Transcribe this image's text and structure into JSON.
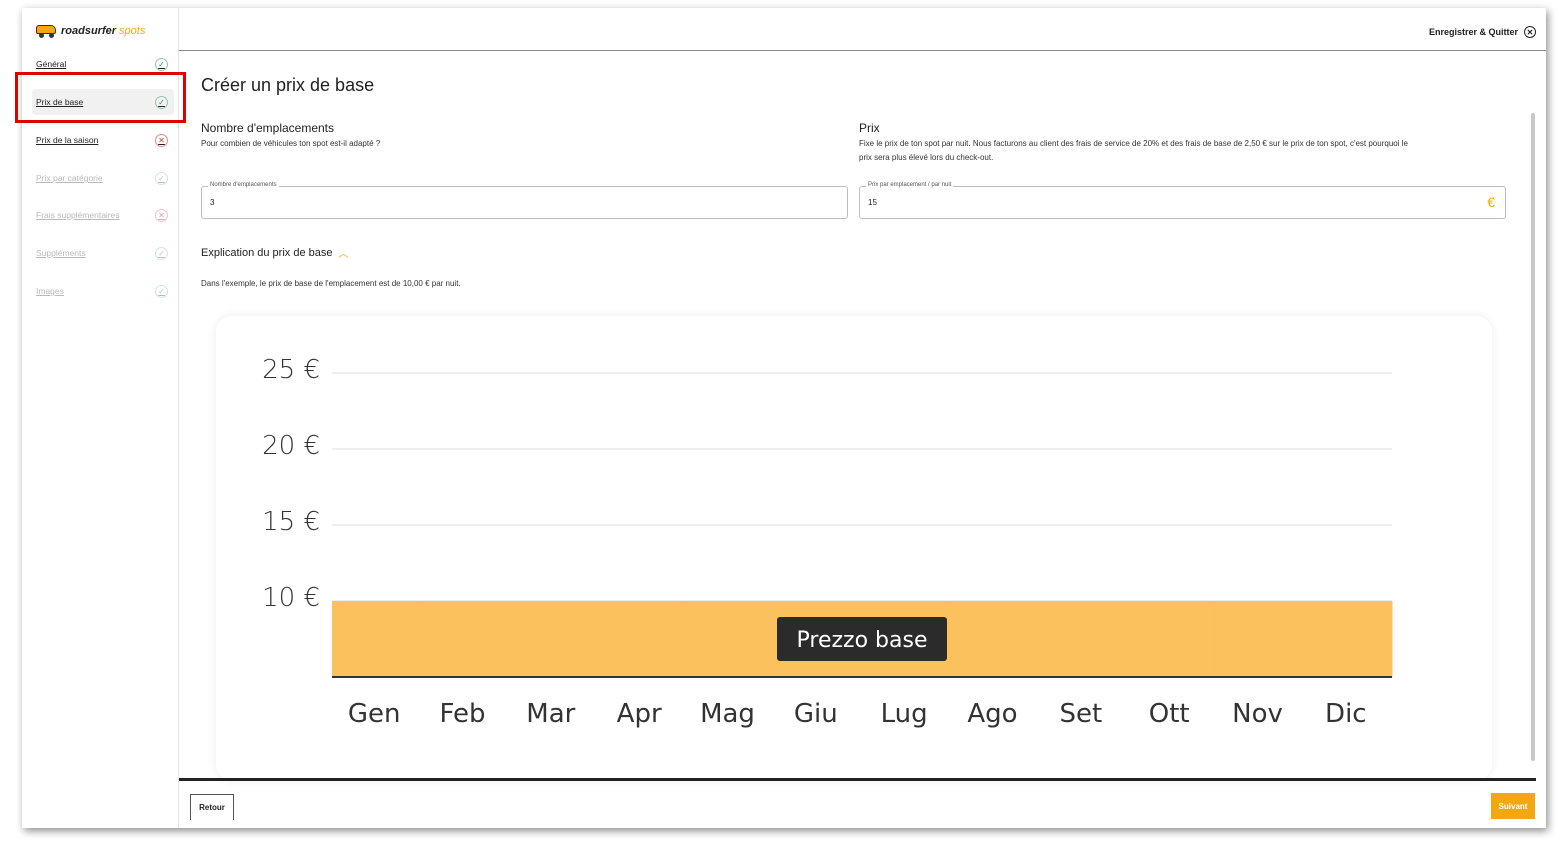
{
  "app": {
    "logo_text": "roadsurfer",
    "logo_suffix": "spots"
  },
  "header": {
    "save_quit": "Enregistrer & Quitter"
  },
  "sidebar": {
    "items": [
      {
        "label": "Général",
        "status": "ok"
      },
      {
        "label": "Prix de base",
        "status": "ok"
      },
      {
        "label": "Prix de la saison",
        "status": "error"
      },
      {
        "label": "Prix par catégorie",
        "status": "ok"
      },
      {
        "label": "Frais supplémentaires",
        "status": "error"
      },
      {
        "label": "Suppléments",
        "status": "ok"
      },
      {
        "label": "Images",
        "status": "ok"
      }
    ]
  },
  "main": {
    "title": "Créer un prix de base",
    "places": {
      "title": "Nombre d'emplacements",
      "desc": "Pour combien de véhicules ton spot est-il adapté ?",
      "field_label": "Nombre d'emplacements",
      "field_value": "3"
    },
    "price": {
      "title": "Prix",
      "desc1": "Fixe le prix de ton spot par nuit. Nous facturons au client des frais de service de 20% et des frais de base de 2,50 € sur le prix de ton spot, c'est pourquoi le",
      "desc2": "prix sera plus élevé lors du check-out.",
      "field_label": "Prix par emplacement / par nuit",
      "field_value": "15",
      "currency": "€"
    },
    "explain_title": "Explication du prix de base",
    "example_text": "Dans l'exemple, le prix de base de l'emplacement est de 10,00 € par nuit."
  },
  "chart_data": {
    "type": "area",
    "categories": [
      "Gen",
      "Feb",
      "Mar",
      "Apr",
      "Mag",
      "Giu",
      "Lug",
      "Ago",
      "Set",
      "Ott",
      "Nov",
      "Dic"
    ],
    "series": [
      {
        "values": [
          10,
          10,
          10,
          10,
          10,
          10,
          10,
          10,
          10,
          10,
          10,
          10
        ]
      }
    ],
    "band_label": "Prezzo base",
    "ylim": [
      5,
      25
    ],
    "yticks": [
      "25 €",
      "20 €",
      "15 €",
      "10 €"
    ],
    "ytick_values": [
      25,
      20,
      15,
      10
    ],
    "grid": true,
    "colors": {
      "fill": "#fbc15c",
      "grid": "#dddddd",
      "label_bg": "#2b2b2b"
    }
  },
  "footer": {
    "back": "Retour",
    "next": "Suivant"
  }
}
